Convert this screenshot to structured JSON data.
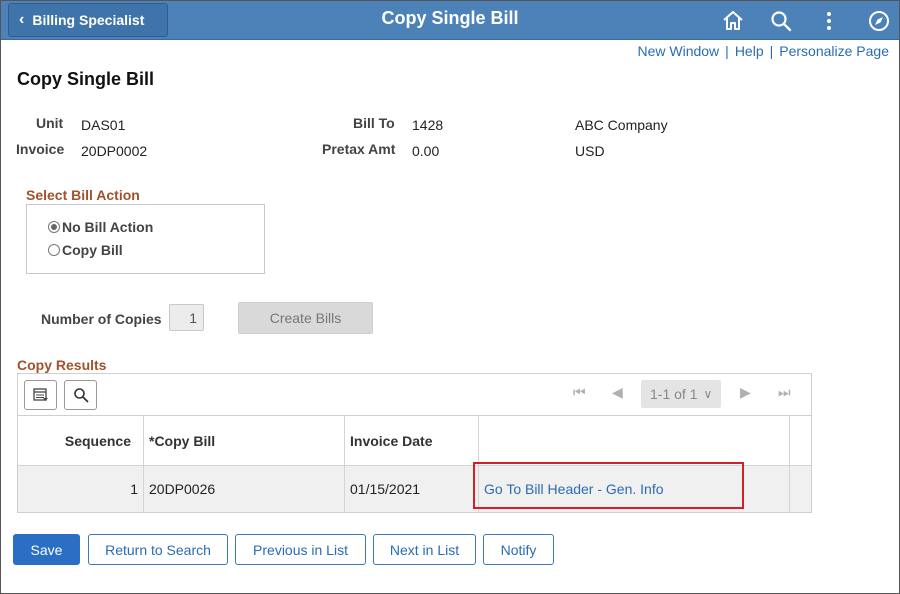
{
  "header": {
    "back_label": "Billing Specialist",
    "title": "Copy Single Bill",
    "icons": [
      "home-icon",
      "search-icon",
      "actions-menu-icon",
      "navbar-icon"
    ]
  },
  "util_links": {
    "new_window": "New Window",
    "help": "Help",
    "personalize": "Personalize Page",
    "separator": "|"
  },
  "page_title": "Copy Single Bill",
  "summary": {
    "unit_label": "Unit",
    "unit_value": "DAS01",
    "invoice_label": "Invoice",
    "invoice_value": "20DP0002",
    "bill_to_label": "Bill To",
    "bill_to_value": "1428",
    "bill_to_name": "ABC Company",
    "pretax_label": "Pretax Amt",
    "pretax_value": "0.00",
    "currency": "USD"
  },
  "bill_action": {
    "title": "Select Bill Action",
    "options": [
      {
        "label": "No Bill Action",
        "selected": true
      },
      {
        "label": "Copy Bill",
        "selected": false
      }
    ]
  },
  "copies": {
    "label": "Number of Copies",
    "value": "1",
    "create_label": "Create Bills"
  },
  "results": {
    "title": "Copy Results",
    "pager": {
      "range": "1-1 of 1"
    },
    "columns": [
      "Sequence",
      "*Copy Bill",
      "Invoice Date",
      ""
    ],
    "rows": [
      {
        "sequence": "1",
        "copy_bill": "20DP0026",
        "invoice_date": "01/15/2021",
        "link": "Go To Bill Header - Gen. Info"
      }
    ]
  },
  "buttons": {
    "save": "Save",
    "return": "Return to Search",
    "previous": "Previous in List",
    "next": "Next in List",
    "notify": "Notify"
  },
  "colors": {
    "header_bg": "#4c82b8",
    "section_title": "#a0522d",
    "link": "#2a6cb3",
    "highlight_box": "#d21f2a",
    "primary_button": "#2b6fc4"
  }
}
